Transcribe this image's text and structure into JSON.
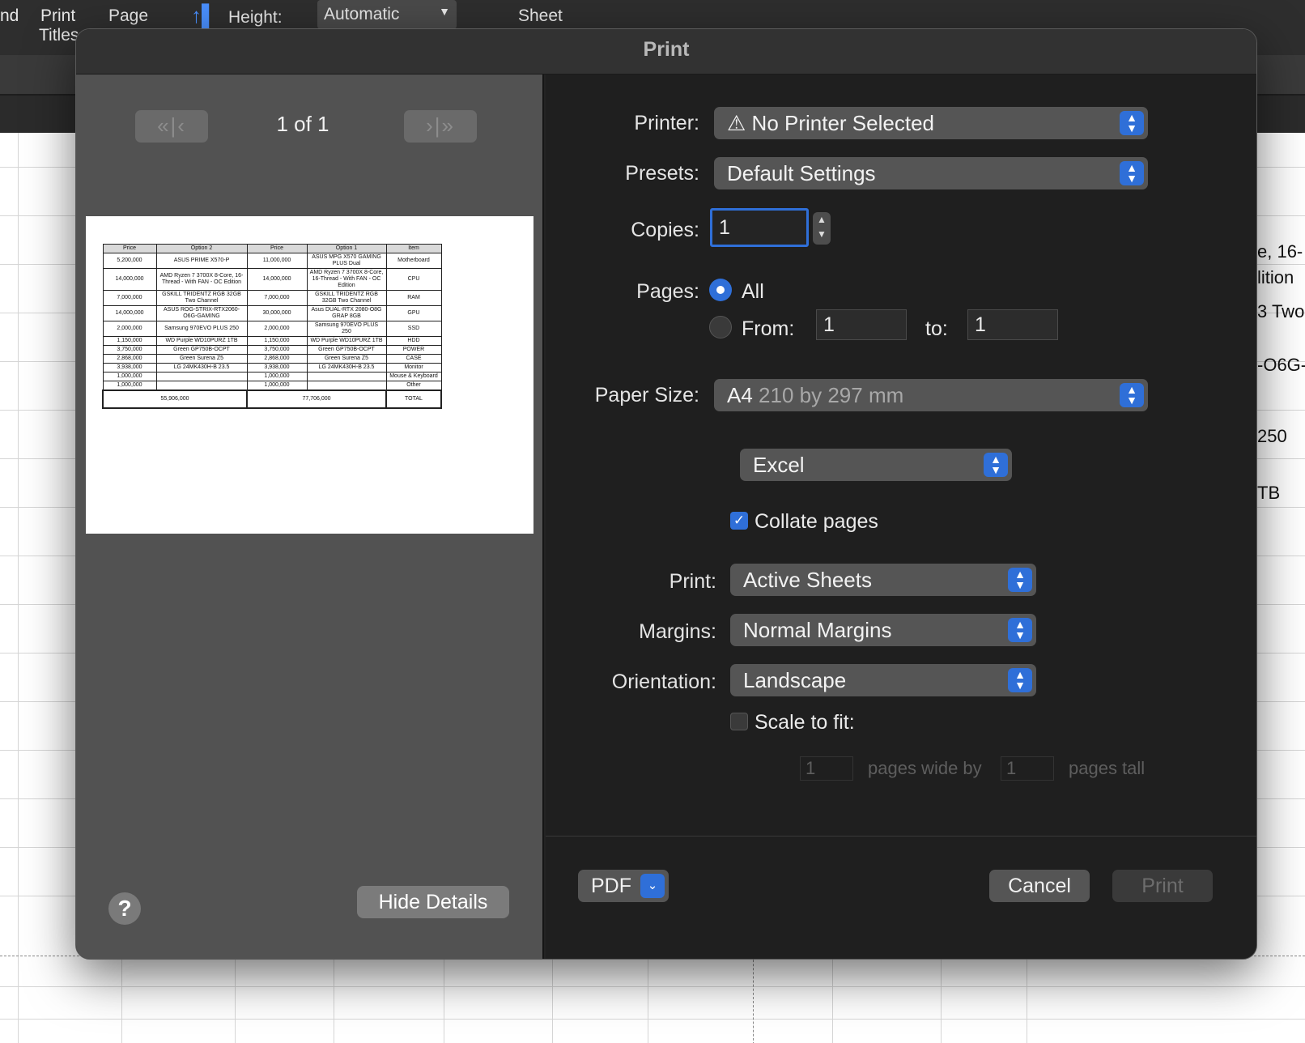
{
  "background": {
    "ribbon": {
      "left_fragment": "nd",
      "print_titles": [
        "Print",
        "Titles"
      ],
      "page": "Page",
      "height_label": "Height:",
      "height_value": "Automatic",
      "sheet": "Sheet"
    },
    "sheet_fragments": [
      "e, 16-",
      "lition",
      "3 Two",
      "-O6G-",
      "250",
      "TB"
    ]
  },
  "dialog": {
    "title": "Print",
    "preview": {
      "page_indicator": "1 of 1",
      "table": {
        "headers": [
          "Price",
          "Option 2",
          "Price",
          "Option 1",
          "Item"
        ],
        "rows": [
          [
            "5,200,000",
            "ASUS PRIME X570-P",
            "11,000,000",
            "ASUS MPG X570 GAMING PLUS Dual",
            "Motherboard"
          ],
          [
            "14,000,000",
            "AMD Ryzen 7 3700X 8-Core, 16-Thread - With FAN - OC Edition",
            "14,000,000",
            "AMD Ryzen 7 3700X 8-Core, 16-Thread - With FAN - OC Edition",
            "CPU"
          ],
          [
            "7,000,000",
            "GSKILL TRIDENTZ RGB 32GB Two Channel",
            "7,000,000",
            "GSKILL TRIDENTZ RGB 32GB Two Channel",
            "RAM"
          ],
          [
            "14,000,000",
            "ASUS ROG-STRIX-RTX2060-O6G-GAMING",
            "30,000,000",
            "Asus DUAL-RTX 2080-O8G GRAP 8GB",
            "GPU"
          ],
          [
            "2,000,000",
            "Samsung 970EVO PLUS 250",
            "2,000,000",
            "Samsung 970EVO PLUS 250",
            "SSD"
          ],
          [
            "1,150,000",
            "WD Purple WD10PURZ 1TB",
            "1,150,000",
            "WD Purple WD10PURZ 1TB",
            "HDD"
          ],
          [
            "3,750,000",
            "Green GP750B-OCPT",
            "3,750,000",
            "Green GP750B-OCPT",
            "POWER"
          ],
          [
            "2,868,000",
            "Green Surena Z5",
            "2,868,000",
            "Green Surena Z5",
            "CASE"
          ],
          [
            "3,938,000",
            "LG 24MK430H-B 23.5",
            "3,938,000",
            "LG 24MK430H-B 23.5",
            "Monitor"
          ],
          [
            "1,000,000",
            "",
            "1,000,000",
            "",
            "Mouse & Keyboard"
          ],
          [
            "1,000,000",
            "",
            "1,000,000",
            "",
            "Other"
          ]
        ],
        "totals": [
          "55,906,000",
          "77,706,000",
          "TOTAL"
        ]
      }
    },
    "help_label": "?",
    "hide_details_label": "Hide Details",
    "printer": {
      "label": "Printer:",
      "value": "No Printer Selected",
      "icon": "warning-icon"
    },
    "presets": {
      "label": "Presets:",
      "value": "Default Settings"
    },
    "copies": {
      "label": "Copies:",
      "value": "1"
    },
    "pages": {
      "label": "Pages:",
      "all_label": "All",
      "from_label": "From:",
      "from_value": "1",
      "to_label": "to:",
      "to_value": "1",
      "selected": "All"
    },
    "paper_size": {
      "label": "Paper Size:",
      "value": "A4",
      "detail": "210 by 297 mm"
    },
    "app_section": {
      "value": "Excel"
    },
    "collate": {
      "label": "Collate pages",
      "checked": true
    },
    "print_what": {
      "label": "Print:",
      "value": "Active Sheets"
    },
    "margins": {
      "label": "Margins:",
      "value": "Normal Margins"
    },
    "orientation": {
      "label": "Orientation:",
      "value": "Landscape"
    },
    "scale_to_fit": {
      "label": "Scale to fit:",
      "checked": false,
      "wide_value": "1",
      "wide_label": "pages wide by",
      "tall_value": "1",
      "tall_label": "pages tall"
    },
    "pdf_label": "PDF",
    "cancel_label": "Cancel",
    "print_label": "Print"
  },
  "colors": {
    "accent": "#2f6fd8",
    "dialog_bg": "#232323",
    "left_pane": "#525252"
  }
}
